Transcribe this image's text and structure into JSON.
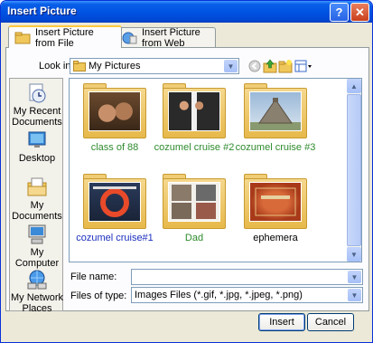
{
  "window": {
    "title": "Insert Picture"
  },
  "tabs": [
    {
      "label": "Insert Picture from File",
      "active": true
    },
    {
      "label": "Insert Picture from Web",
      "active": false
    }
  ],
  "lookin": {
    "label": "Look in:",
    "value": "My Pictures"
  },
  "places": [
    {
      "label": "My Recent Documents",
      "icon": "recent-documents-icon"
    },
    {
      "label": "Desktop",
      "icon": "desktop-icon"
    },
    {
      "label": "My Documents",
      "icon": "my-documents-icon"
    },
    {
      "label": "My Computer",
      "icon": "my-computer-icon"
    },
    {
      "label": "My Network Places",
      "icon": "network-places-icon"
    }
  ],
  "items": [
    {
      "label": "class of 88",
      "color": "#2e8b2e"
    },
    {
      "label": "cozumel cruise #2",
      "color": "#2e8b2e"
    },
    {
      "label": "cozumel cruise #3",
      "color": "#2e8b2e"
    },
    {
      "label": "cozumel cruise#1",
      "color": "#1c2fbf"
    },
    {
      "label": "Dad",
      "color": "#2e8b2e"
    },
    {
      "label": "ephemera",
      "color": "#000000"
    }
  ],
  "filename": {
    "label": "File name:",
    "value": ""
  },
  "filetype": {
    "label": "Files of type:",
    "value": "Images Files (*.gif, *.jpg, *.jpeg, *.png)"
  },
  "buttons": {
    "insert": "Insert",
    "cancel": "Cancel"
  }
}
